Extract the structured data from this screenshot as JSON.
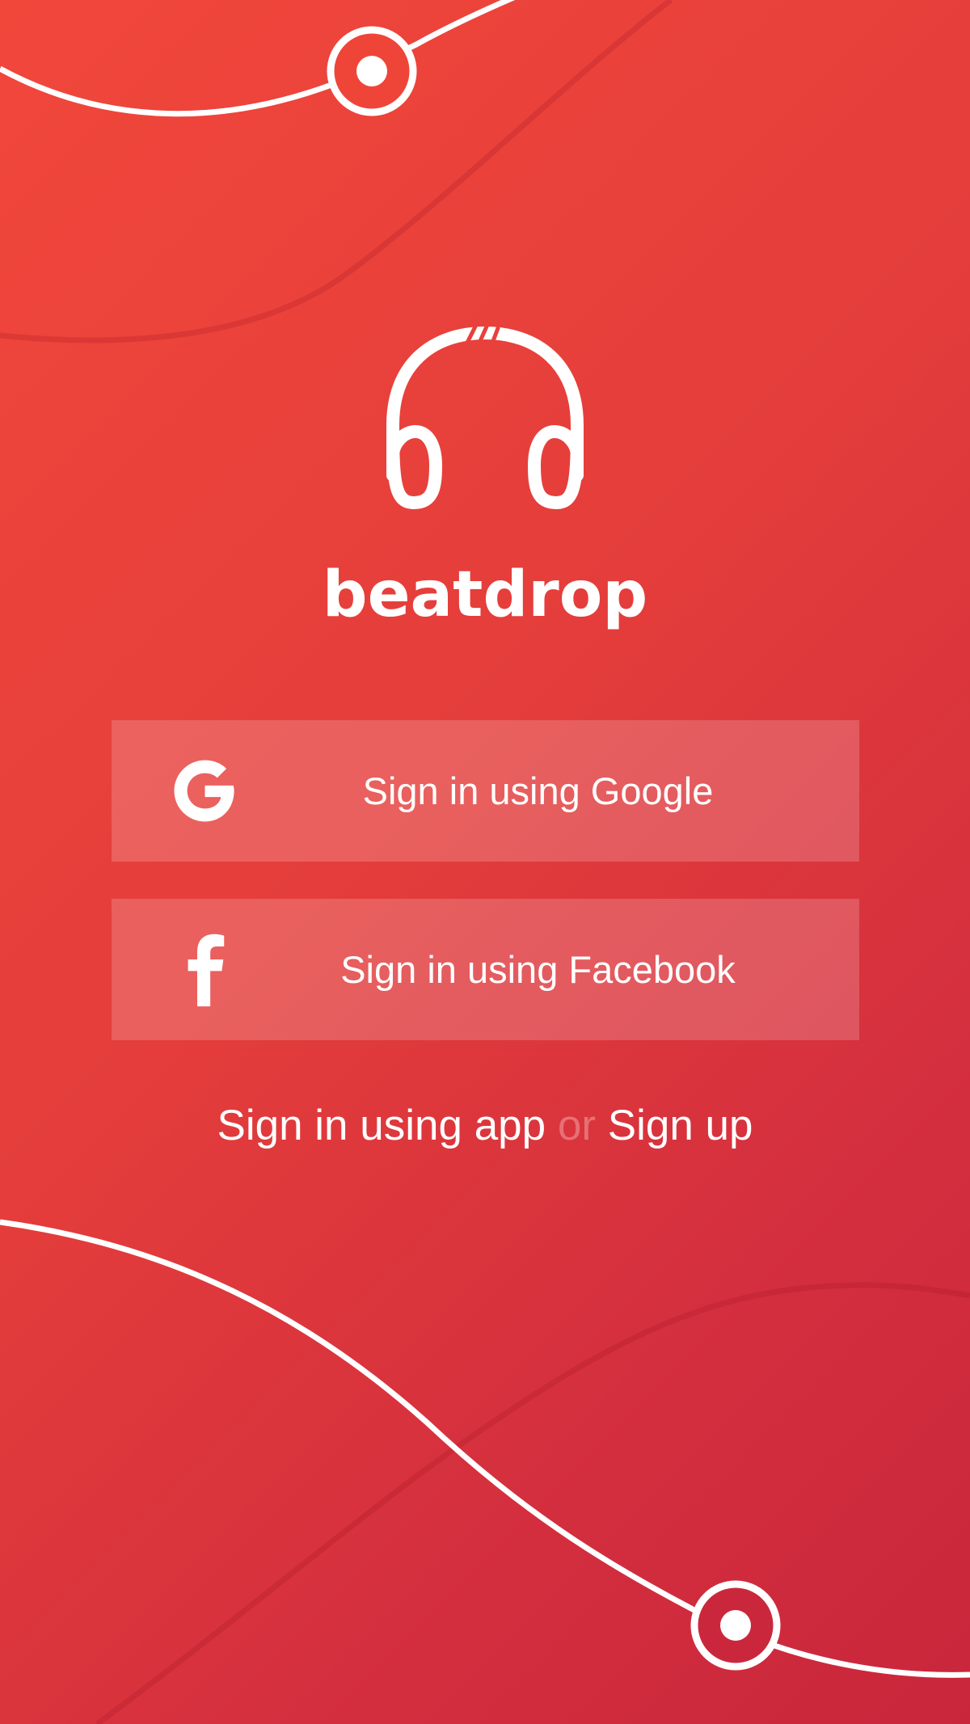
{
  "app": {
    "name": "beatdrop",
    "logo_icon": "headphones-icon"
  },
  "buttons": {
    "google": {
      "label": "Sign in using Google",
      "icon": "google-icon"
    },
    "facebook": {
      "label": "Sign in using Facebook",
      "icon": "facebook-icon"
    }
  },
  "links": {
    "signin_app": "Sign in using app",
    "separator": "or",
    "signup": "Sign up"
  },
  "colors": {
    "background_start": "#f1473b",
    "background_end": "#c9263c",
    "button_fill": "rgba(255,255,255,0.18)",
    "separator_text": "#e77075",
    "text": "#ffffff"
  }
}
